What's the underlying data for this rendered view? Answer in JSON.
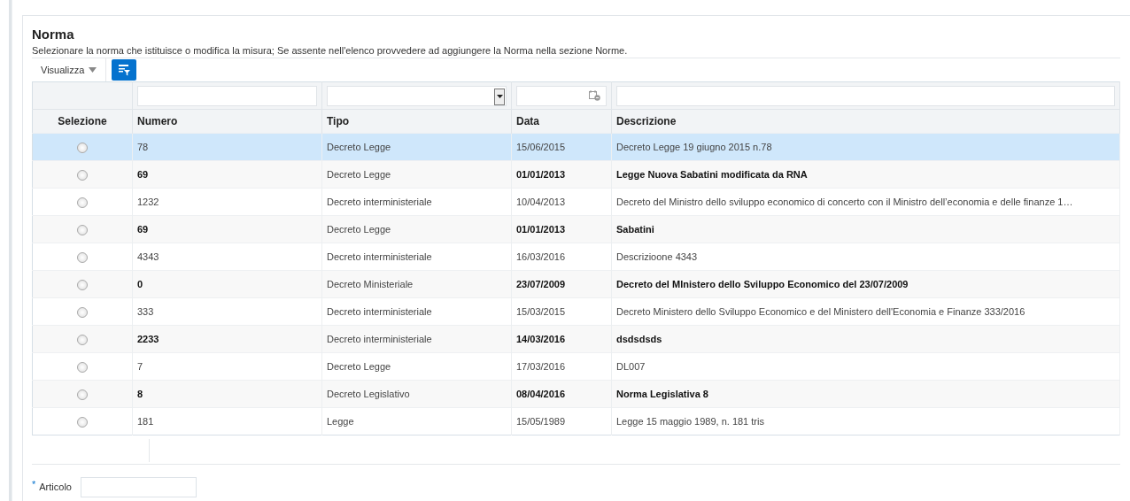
{
  "section": {
    "title": "Norma",
    "description": "Selezionare la norma che istituisce o modifica la misura; Se assente nell'elenco provvedere ad aggiungere la Norma nella sezione Norme."
  },
  "toolbar": {
    "view_menu": "Visualizza"
  },
  "table": {
    "columns": [
      "Selezione",
      "Numero",
      "Tipo",
      "Data",
      "Descrizione"
    ],
    "rows": [
      {
        "numero": "78",
        "tipo": "Decreto Legge",
        "data": "15/06/2015",
        "descrizione": "Decreto Legge 19 giugno 2015 n.78",
        "selected": true,
        "checked": false
      },
      {
        "numero": "69",
        "tipo": "Decreto Legge",
        "data": "01/01/2013",
        "descrizione": "Legge Nuova Sabatini modificata da RNA",
        "selected": false,
        "checked": false
      },
      {
        "numero": "1232",
        "tipo": "Decreto interministeriale",
        "data": "10/04/2013",
        "descrizione": "Decreto del Ministro dello sviluppo economico di concerto con il Ministro dell’economia e delle finanze 1…",
        "selected": false,
        "checked": false
      },
      {
        "numero": "69",
        "tipo": "Decreto Legge",
        "data": "01/01/2013",
        "descrizione": "Sabatini",
        "selected": false,
        "checked": false
      },
      {
        "numero": "4343",
        "tipo": "Decreto interministeriale",
        "data": "16/03/2016",
        "descrizione": "Descrizioone 4343",
        "selected": false,
        "checked": false
      },
      {
        "numero": "0",
        "tipo": "Decreto Ministeriale",
        "data": "23/07/2009",
        "descrizione": "Decreto del MInistero dello Sviluppo Economico del 23/07/2009",
        "selected": false,
        "checked": false
      },
      {
        "numero": "333",
        "tipo": "Decreto interministeriale",
        "data": "15/03/2015",
        "descrizione": "Decreto Ministero dello Sviluppo Economico e del Ministero dell'Economia e Finanze 333/2016",
        "selected": false,
        "checked": false
      },
      {
        "numero": "2233",
        "tipo": "Decreto interministeriale",
        "data": "14/03/2016",
        "descrizione": "dsdsdsds",
        "selected": false,
        "checked": false
      },
      {
        "numero": "7",
        "tipo": "Decreto Legge",
        "data": "17/03/2016",
        "descrizione": "DL007",
        "selected": false,
        "checked": false
      },
      {
        "numero": "8",
        "tipo": "Decreto Legislativo",
        "data": "08/04/2016",
        "descrizione": "Norma Legislativa 8",
        "selected": false,
        "checked": false
      },
      {
        "numero": "181",
        "tipo": "Legge",
        "data": "15/05/1989",
        "descrizione": "Legge 15 maggio 1989, n. 181 tris",
        "selected": false,
        "checked": false
      }
    ]
  },
  "articolo": {
    "required_mark": "*",
    "label": "Articolo"
  }
}
